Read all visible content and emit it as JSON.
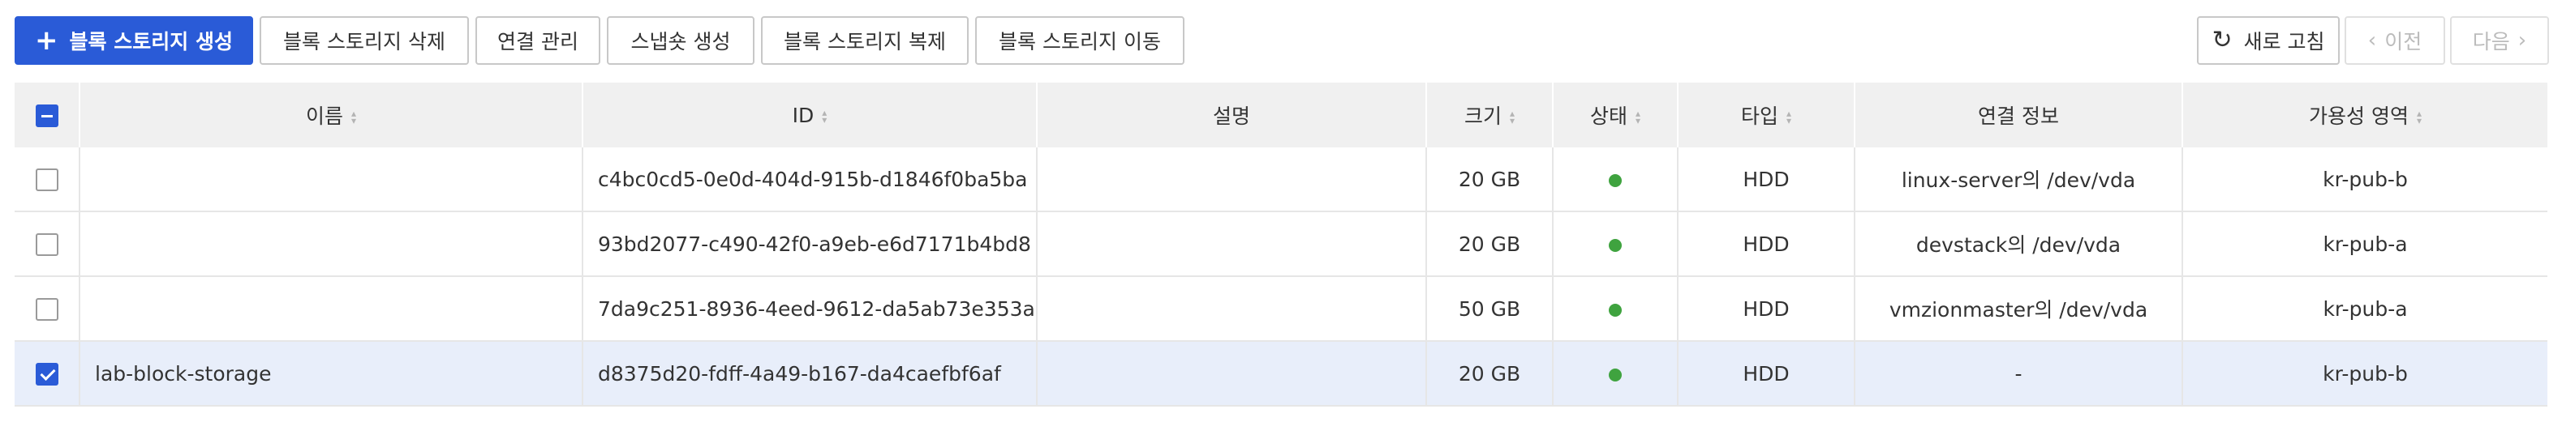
{
  "toolbar": {
    "create": "블록 스토리지 생성",
    "delete": "블록 스토리지 삭제",
    "connections": "연결 관리",
    "snapshot": "스냅숏 생성",
    "clone": "블록 스토리지 복제",
    "move": "블록 스토리지 이동",
    "refresh": "새로 고침",
    "prev": "이전",
    "next": "다음"
  },
  "icons": {
    "create": "plus-icon",
    "refresh": "refresh-icon",
    "prev": "chevron-left-icon",
    "next": "chevron-right-icon",
    "sort": "sort-icon"
  },
  "colors": {
    "primary": "#2a5bd7",
    "status_ok": "#3fa33f",
    "selected_row": "#e8eefa",
    "header_bg": "#f0f0f0"
  },
  "table": {
    "select_all_state": "indeterminate",
    "columns": {
      "name": "이름",
      "id": "ID",
      "description": "설명",
      "size": "크기",
      "status": "상태",
      "type": "타입",
      "connection": "연결 정보",
      "zone": "가용성 영역"
    },
    "rows": [
      {
        "checked": false,
        "name": "",
        "id": "c4bc0cd5-0e0d-404d-915b-d1846f0ba5ba",
        "description": "",
        "size": "20 GB",
        "status": "ok",
        "type": "HDD",
        "connection": "linux-server의 /dev/vda",
        "zone": "kr-pub-b"
      },
      {
        "checked": false,
        "name": "",
        "id": "93bd2077-c490-42f0-a9eb-e6d7171b4bd8",
        "description": "",
        "size": "20 GB",
        "status": "ok",
        "type": "HDD",
        "connection": "devstack의 /dev/vda",
        "zone": "kr-pub-a"
      },
      {
        "checked": false,
        "name": "",
        "id": "7da9c251-8936-4eed-9612-da5ab73e353a",
        "description": "",
        "size": "50 GB",
        "status": "ok",
        "type": "HDD",
        "connection": "vmzionmaster의 /dev/vda",
        "zone": "kr-pub-a"
      },
      {
        "checked": true,
        "name": "lab-block-storage",
        "id": "d8375d20-fdff-4a49-b167-da4caefbf6af",
        "description": "",
        "size": "20 GB",
        "status": "ok",
        "type": "HDD",
        "connection": "-",
        "zone": "kr-pub-b"
      }
    ]
  }
}
